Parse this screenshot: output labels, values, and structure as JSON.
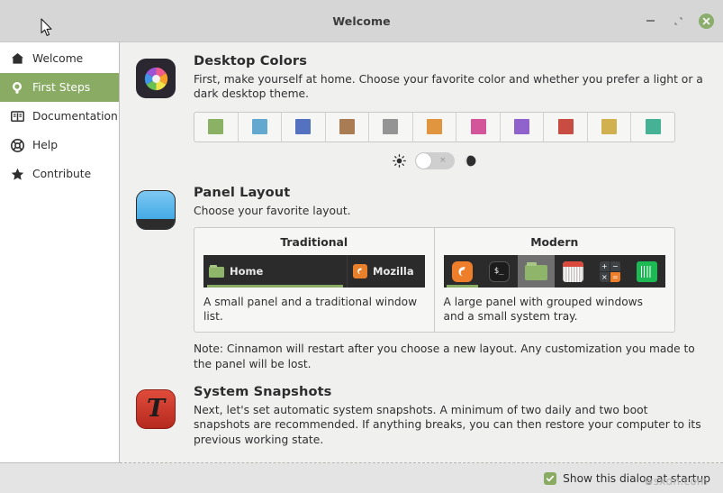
{
  "window": {
    "title": "Welcome",
    "controls": {
      "minimize": "minimize-button",
      "maximize": "maximize-button",
      "close": "close-button"
    }
  },
  "sidebar": {
    "items": [
      {
        "label": "Welcome",
        "icon": "home-icon",
        "active": false
      },
      {
        "label": "First Steps",
        "icon": "lightbulb-icon",
        "active": true
      },
      {
        "label": "Documentation",
        "icon": "book-icon",
        "active": false
      },
      {
        "label": "Help",
        "icon": "lifebuoy-icon",
        "active": false
      },
      {
        "label": "Contribute",
        "icon": "star-icon",
        "active": false
      }
    ]
  },
  "sections": {
    "desktop_colors": {
      "title": "Desktop Colors",
      "description": "First, make yourself at home. Choose your favorite color and whether you prefer a light or a dark desktop theme.",
      "icon": "color-wheel-icon",
      "swatches": [
        {
          "name": "green",
          "hex": "#8bb165"
        },
        {
          "name": "blue",
          "hex": "#62a8cf"
        },
        {
          "name": "indigo",
          "hex": "#5572c0"
        },
        {
          "name": "brown",
          "hex": "#a97c54"
        },
        {
          "name": "grey",
          "hex": "#949494"
        },
        {
          "name": "orange",
          "hex": "#e0953e"
        },
        {
          "name": "pink",
          "hex": "#d4569a"
        },
        {
          "name": "purple",
          "hex": "#9063cc"
        },
        {
          "name": "red",
          "hex": "#c94c43"
        },
        {
          "name": "yellow",
          "hex": "#d1b050"
        },
        {
          "name": "teal",
          "hex": "#45b195"
        }
      ],
      "theme_toggle": {
        "light_icon": "sun-icon",
        "dark_icon": "moon-icon",
        "state": "off",
        "off_mark": "×"
      }
    },
    "panel_layout": {
      "title": "Panel Layout",
      "description": "Choose your favorite layout.",
      "icon": "panel-icon",
      "cards": [
        {
          "title": "Traditional",
          "description": "A small panel and a traditional window list.",
          "preview_items": [
            {
              "label": "Home",
              "icon": "folder-icon"
            },
            {
              "label": "Mozilla",
              "icon": "firefox-icon"
            }
          ]
        },
        {
          "title": "Modern",
          "description": "A large panel with grouped windows and a small system tray.",
          "preview_items": [
            {
              "icon": "firefox-icon"
            },
            {
              "icon": "terminal-icon"
            },
            {
              "icon": "files-icon"
            },
            {
              "icon": "calendar-icon"
            },
            {
              "icon": "calculator-icon"
            },
            {
              "icon": "spreadsheet-icon"
            }
          ]
        }
      ],
      "note": "Note: Cinnamon will restart after you choose a new layout. Any customization you made to the panel will be lost."
    },
    "system_snapshots": {
      "title": "System Snapshots",
      "description": "Next, let's set automatic system snapshots. A minimum of two daily and two boot snapshots are recommended. If anything breaks, you can then restore your computer to its previous working state.",
      "icon": "timeshift-icon",
      "icon_glyph": "T"
    }
  },
  "footer": {
    "checkbox_checked": true,
    "label": "Show this dialog at startup"
  },
  "watermark": "wsxdn.com",
  "colors": {
    "accent": "#8aab63",
    "titlebar_bg": "#d6d6d6",
    "content_bg": "#f0f0ef",
    "sidebar_bg": "#ffffff",
    "footer_bg": "#e4e4e4"
  }
}
